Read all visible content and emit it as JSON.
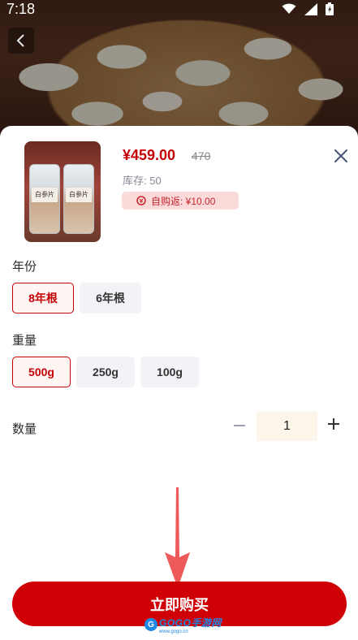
{
  "status_bar": {
    "time": "7:18"
  },
  "product": {
    "price": "¥459.00",
    "original_price": "470",
    "stock_text": "库存: 50",
    "rebate_text": "自购返: ¥10.00",
    "thumbnail_label": "白参片"
  },
  "year": {
    "label": "年份",
    "options": [
      {
        "label": "8年根",
        "selected": true
      },
      {
        "label": "6年根",
        "selected": false
      }
    ]
  },
  "weight": {
    "label": "重量",
    "options": [
      {
        "label": "500g",
        "selected": true
      },
      {
        "label": "250g",
        "selected": false
      },
      {
        "label": "100g",
        "selected": false
      }
    ]
  },
  "quantity": {
    "label": "数量",
    "value": "1"
  },
  "buy_button": {
    "label": "立即购买"
  },
  "watermark": {
    "text": "GOGO手游网",
    "sub": "www.gogo.cn"
  },
  "colors": {
    "accent": "#c40006",
    "button": "#cf0006",
    "arrow": "#ee5a5a"
  }
}
